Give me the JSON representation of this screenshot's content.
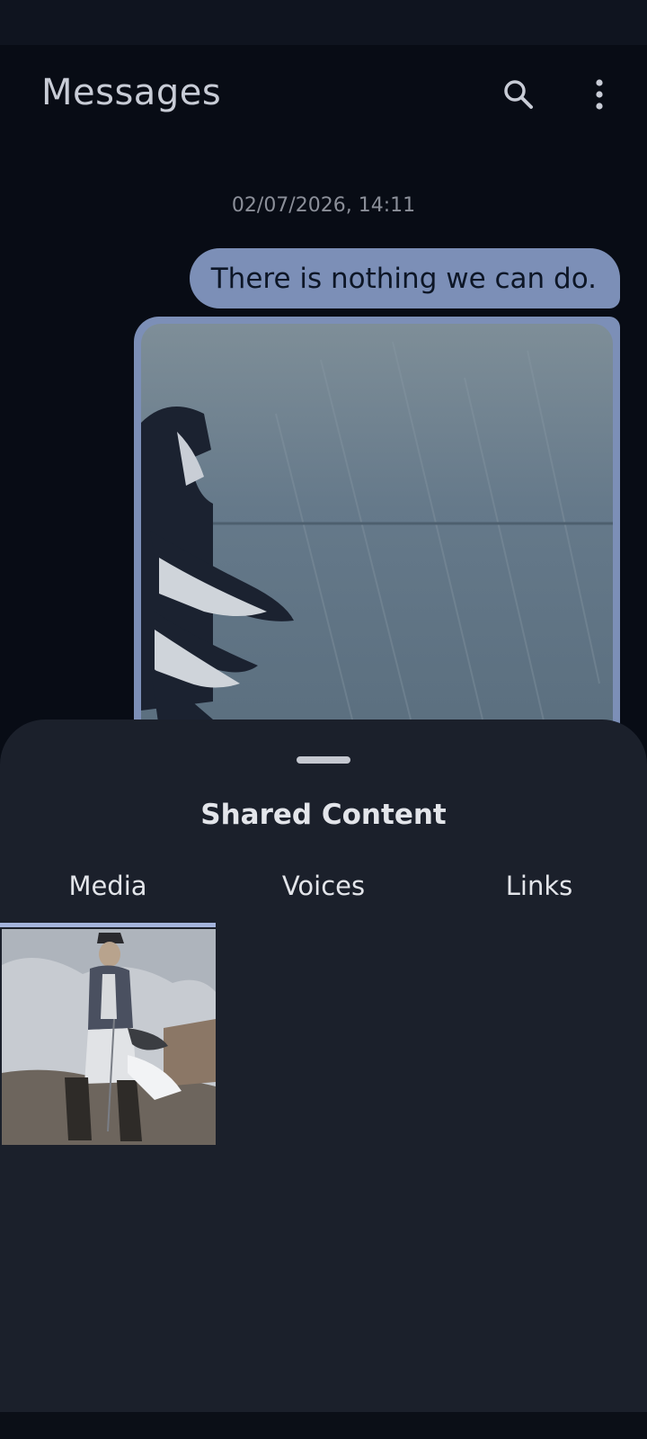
{
  "app_bar": {
    "title": "Messages",
    "search_icon": "search-icon",
    "more_icon": "more-vert-icon"
  },
  "chat": {
    "timestamp": "02/07/2026, 14:11",
    "message_text": "There is nothing we can do.",
    "bubble_color": "#7c8fb7"
  },
  "sheet": {
    "title": "Shared Content",
    "tabs": [
      {
        "label": "Media",
        "selected": true
      },
      {
        "label": "Voices",
        "selected": false
      },
      {
        "label": "Links",
        "selected": false
      }
    ],
    "indicator_color": "#a4b4dc"
  }
}
